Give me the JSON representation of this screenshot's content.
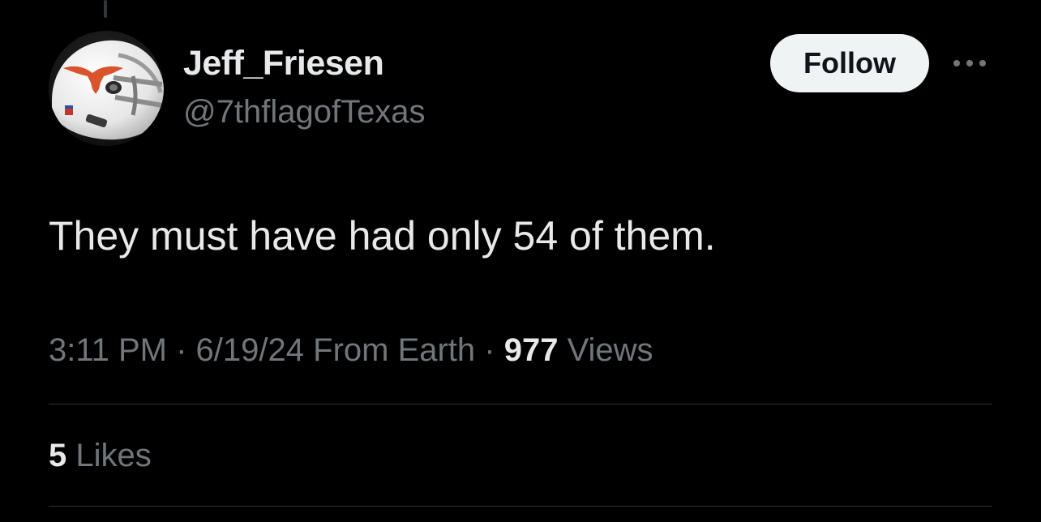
{
  "author": {
    "display_name": "Jeff_Friesen",
    "handle": "@7thflagofTexas",
    "avatar_icon": "longhorn-helmet-avatar"
  },
  "actions": {
    "follow_label": "Follow",
    "more_icon": "more-horizontal-icon"
  },
  "tweet": {
    "text": "They must have had only 54 of them.",
    "time": "3:11 PM",
    "separator": " · ",
    "date": "6/19/24",
    "location": " From Earth",
    "views_count": "977",
    "views_label": " Views"
  },
  "engagement": {
    "likes_count": "5",
    "likes_label": " Likes"
  },
  "colors": {
    "background": "#000000",
    "primary_text": "#e7e9ea",
    "secondary_text": "#71767b",
    "follow_button_bg": "#eff3f4",
    "divider": "#2f3336",
    "longhorn_orange": "#d9532c"
  }
}
